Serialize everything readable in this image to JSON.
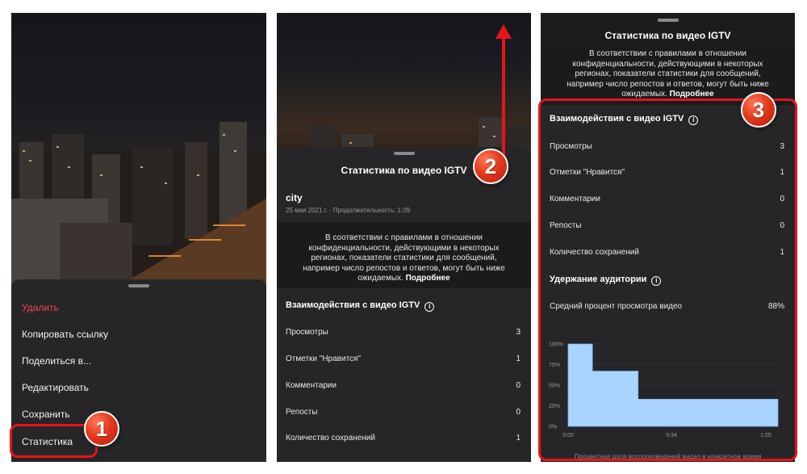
{
  "panel1": {
    "menu": [
      {
        "label": "Удалить",
        "danger": true
      },
      {
        "label": "Копировать ссылку"
      },
      {
        "label": "Поделиться в..."
      },
      {
        "label": "Редактировать"
      },
      {
        "label": "Сохранить"
      },
      {
        "label": "Статистика"
      }
    ],
    "step": "1"
  },
  "panel2": {
    "sheet_title": "Статистика по видео IGTV",
    "video_title": "city",
    "video_meta": "25 мая 2021 г. · Продолжительность: 1:09",
    "notice_text": "В соответствии с правилами в отношении конфиденциальности, действующими в некоторых регионах, показатели статистики для сообщений, например число репостов и ответов, могут быть ниже ожидаемых. ",
    "notice_link": "Подробнее",
    "section_title": "Взаимодействия с видео IGTV",
    "rows": [
      {
        "label": "Просмотры",
        "value": "3"
      },
      {
        "label": "Отметки \"Нравится\"",
        "value": "1"
      },
      {
        "label": "Комментарии",
        "value": "0"
      },
      {
        "label": "Репосты",
        "value": "0"
      },
      {
        "label": "Количество сохранений",
        "value": "1"
      }
    ],
    "step": "2"
  },
  "panel3": {
    "sheet_title": "Статистика по видео IGTV",
    "notice_text": "В соответствии с правилами в отношении конфиденциальности, действующими в некоторых регионах, показатели статистики для сообщений, например число репостов и ответов, могут быть ниже ожидаемых. ",
    "notice_link": "Подробнее",
    "section_title": "Взаимодействия с видео IGTV",
    "rows": [
      {
        "label": "Просмотры",
        "value": "3"
      },
      {
        "label": "Отметки \"Нравится\"",
        "value": "1"
      },
      {
        "label": "Комментарии",
        "value": "0"
      },
      {
        "label": "Репосты",
        "value": "0"
      },
      {
        "label": "Количество сохранений",
        "value": "1"
      }
    ],
    "retention_title": "Удержание аудитории",
    "avg_label": "Средний процент просмотра видео",
    "avg_value": "88%",
    "chart_caption": "Процентная доля воспроизведений видео в конкретное время",
    "step": "3"
  },
  "colors": {
    "accent_red": "#e4141b",
    "fill_blue": "#a8d4ff",
    "danger": "#ed4956"
  },
  "chart_data": {
    "type": "area",
    "x": [
      0,
      8,
      8,
      23,
      23,
      69
    ],
    "x_unit": "seconds",
    "y": [
      100,
      100,
      67,
      67,
      33,
      33
    ],
    "y_ticks": [
      "100%",
      "75%",
      "50%",
      "25%",
      "0%"
    ],
    "x_ticks": [
      "0:00",
      "0:34",
      "1:05"
    ],
    "ylim": [
      0,
      100
    ],
    "xlim": [
      0,
      69
    ]
  }
}
